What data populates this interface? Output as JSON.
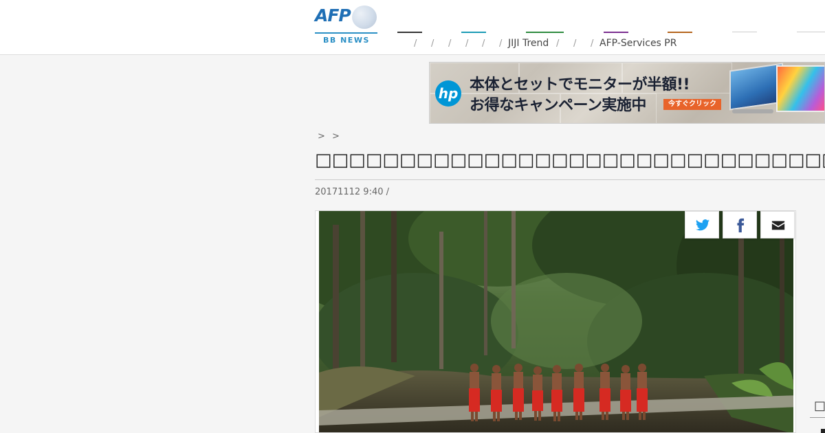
{
  "header": {
    "logo": {
      "brand": "AFP",
      "subtitle": "BB NEWS"
    },
    "nav": {
      "separators": [
        "/",
        "/",
        "/",
        "/",
        "/",
        "/",
        "/"
      ],
      "items": [
        {
          "label": "",
          "color": "#333333"
        },
        {
          "label": "",
          "color": "#1a9bb5"
        },
        {
          "label": "JIJI Trend",
          "color": "#2e8b3e"
        },
        {
          "label": "",
          "color": "#7a2d8f"
        },
        {
          "label": "AFP-Services PR",
          "color": "#b5651d"
        },
        {
          "label": "",
          "color": "#cccccc"
        },
        {
          "label": "",
          "color": "#cccccc"
        }
      ]
    }
  },
  "ad": {
    "brand": "hp",
    "line1": "本体とセットでモニターが半額!!",
    "line2": "お得なキャンペーン実施中",
    "cta": "今すぐクリック"
  },
  "article": {
    "breadcrumb": "> >",
    "title": "□□□□□□□□□□□□□□□□□□□□□□□□□□□□□□□□□□□□□□□□□□□□□□",
    "dateline": "20171112 9:40  /",
    "photo_people_count": 9
  },
  "share": {
    "twitter_icon": "twitter-icon",
    "facebook_icon": "facebook-icon",
    "email_icon": "envelope-icon"
  },
  "edge": {
    "glyph": "□"
  }
}
